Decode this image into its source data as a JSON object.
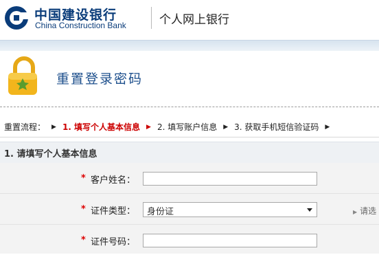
{
  "header": {
    "bank_name_cn": "中国建设银行",
    "bank_name_en": "China Construction Bank",
    "site_name": "个人网上银行",
    "brand_color": "#0a3c7a"
  },
  "page": {
    "title": "重置登录密码",
    "icon": "padlock-icon"
  },
  "steps": {
    "prefix": "重置流程：",
    "items": [
      {
        "label": "1. 填写个人基本信息",
        "active": true
      },
      {
        "label": "2. 填写账户信息",
        "active": false
      },
      {
        "label": "3. 获取手机短信验证码",
        "active": false
      }
    ],
    "active_color": "#cc0000"
  },
  "section": {
    "title": "1. 请填写个人基本信息"
  },
  "form": {
    "required_mark": "*",
    "name_label": "客户姓名：",
    "name_value": "",
    "id_type_label": "证件类型：",
    "id_type_value": "身份证",
    "id_type_hint": "请选",
    "id_number_label": "证件号码：",
    "id_number_value": ""
  }
}
